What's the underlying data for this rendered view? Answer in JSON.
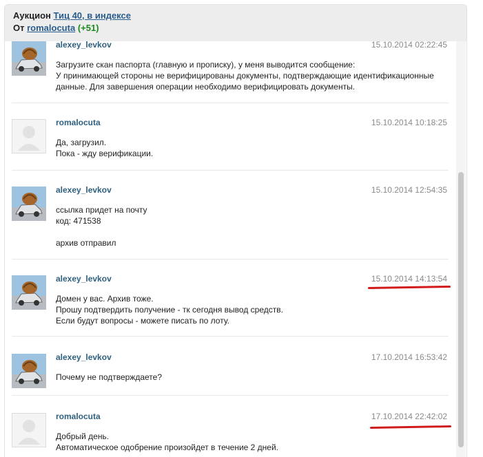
{
  "header": {
    "auction_label": "Аукцион",
    "auction_link": "Тиц 40, в индексе",
    "from_label": "От",
    "from_user": "romalocuta",
    "from_score": "(+51)"
  },
  "messages": [
    {
      "author": "alexey_levkov",
      "date": "15.10.2014 02:22:45",
      "avatar": "car-icon",
      "text": "Загрузите скан паспорта (главную и прописку), у меня выводится сообщение:\nУ принимающей стороны не верифицированы документы, подтверждающие идентификационные данные. Для завершения операции необходимо верифицировать документы."
    },
    {
      "author": "romalocuta",
      "date": "15.10.2014 10:18:25",
      "avatar": "user-placeholder-icon",
      "text": "Да, загрузил.\nПока - жду верификации."
    },
    {
      "author": "alexey_levkov",
      "date": "15.10.2014 12:54:35",
      "avatar": "car-icon",
      "text": "ссылка придет на почту\nкод: 471538\n\nархив отправил"
    },
    {
      "author": "alexey_levkov",
      "date": "15.10.2014 14:13:54",
      "avatar": "car-icon",
      "text": "Домен у вас. Архив тоже.\nПрошу подтвердить получение - тк сегодня вывод средств.\nЕсли будут вопросы - можете писать по лоту."
    },
    {
      "author": "alexey_levkov",
      "date": "17.10.2014 16:53:42",
      "avatar": "car-icon",
      "text": "Почему не подтверждаете?"
    },
    {
      "author": "romalocuta",
      "date": "17.10.2014 22:42:02",
      "avatar": "user-placeholder-icon",
      "text": "Добрый день.\nАвтоматическое одобрение произойдет в течение 2 дней."
    }
  ],
  "colors": {
    "author": "#2f6080",
    "date": "#8a8a8a",
    "highlight": "#d11a1a",
    "score": "#1e8a1e"
  }
}
